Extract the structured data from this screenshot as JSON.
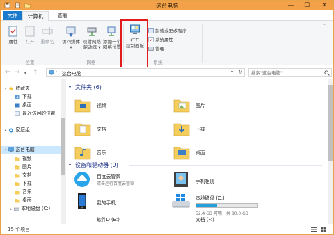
{
  "window": {
    "title": "这台电脑",
    "controls": {
      "minimize": "—",
      "maximize": "☐",
      "close": "✕"
    }
  },
  "tabs": [
    {
      "label": "文件"
    },
    {
      "label": "计算机"
    },
    {
      "label": "查看"
    }
  ],
  "ribbon": {
    "location_group": {
      "label": "位置",
      "properties": "属性",
      "open": "打开",
      "rename": "重命名"
    },
    "network_group": {
      "label": "网络",
      "access_media_1": "访问媒体",
      "map_drive_1": "映射网络",
      "map_drive_2": "驱动器",
      "add_location_1": "添加一个",
      "add_location_2": "网络位置"
    },
    "control_panel": {
      "line1": "打开",
      "line2": "控制面板"
    },
    "system_group": {
      "label": "系统",
      "uninstall": "卸载或更改程序",
      "system_properties": "系统属性",
      "manage": "管理"
    }
  },
  "nav": {
    "address": "这台电脑",
    "search_placeholder": "搜索\"这台电脑\""
  },
  "sidebar": {
    "favorites": "收藏夹",
    "downloads": "下载",
    "desktop": "桌面",
    "recent": "最近访问的位置",
    "homegroup": "家庭组",
    "this_pc": "这台电脑",
    "videos": "视频",
    "pictures": "图片",
    "documents": "文档",
    "downloads2": "下载",
    "music": "音乐",
    "desktop2": "桌面",
    "local_disk": "本地磁盘 (C:)"
  },
  "folders": {
    "header": "文件夹 (6)",
    "items": [
      "视频",
      "图片",
      "文档",
      "下载",
      "音乐",
      "桌面"
    ]
  },
  "devices": {
    "header": "设备和驱动器 (9)",
    "baidu": {
      "name": "百度云管家",
      "sub": "双击运行百度云管家"
    },
    "phone_album": "手机相册",
    "my_phone": "我的手机",
    "local_c": {
      "name": "本地磁盘 (C:)",
      "free": "52.4 GB 可用，共 80.0 GB",
      "used_fraction": 0.345
    },
    "drive_e": "软件D (E:)",
    "drive_f": "文档 (F:)"
  },
  "status": {
    "count": "15 个项目"
  },
  "colors": {
    "titlebar": "#f3a24a",
    "file_tab": "#1979ca",
    "highlight": "#e21b1b",
    "folder": "#f4cd5c"
  }
}
